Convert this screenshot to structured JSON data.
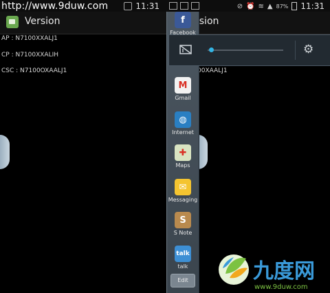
{
  "status_left": {
    "watermark": "http://www.9duw.com",
    "time": "11:31"
  },
  "status_right": {
    "battery": "87%",
    "time": "11:31"
  },
  "left_screen": {
    "title": "Version",
    "info_lines": [
      "AP : N7100XXALJ1",
      "CP : N7100XXALIH",
      "CSC : N7100OXAALJ1"
    ]
  },
  "right_screen": {
    "title": "rsion",
    "partial_info": "00XAALJ1"
  },
  "brightness": {
    "level": 0.05
  },
  "tray": {
    "items": [
      {
        "label": "Facebook",
        "icon": "facebook-icon",
        "color": "#3b5998",
        "glyph": "f"
      },
      {
        "label": "Gmail",
        "icon": "gmail-icon",
        "color": "#f2f2f2",
        "glyph": "M"
      },
      {
        "label": "Internet",
        "icon": "internet-icon",
        "color": "#2a7fc2",
        "glyph": "◍"
      },
      {
        "label": "Maps",
        "icon": "maps-icon",
        "color": "#d9e4c2",
        "glyph": "✚"
      },
      {
        "label": "Messaging",
        "icon": "messaging-icon",
        "color": "#f4c430",
        "glyph": "✉"
      },
      {
        "label": "S Note",
        "icon": "s-note-icon",
        "color": "#b98a4e",
        "glyph": "S"
      },
      {
        "label": "talk",
        "icon": "talk-icon",
        "color": "#3d8fd4",
        "glyph": "talk"
      }
    ],
    "edit_label": "Edit"
  },
  "logo": {
    "brand": "九度网",
    "domain": "www.9duw.com"
  }
}
